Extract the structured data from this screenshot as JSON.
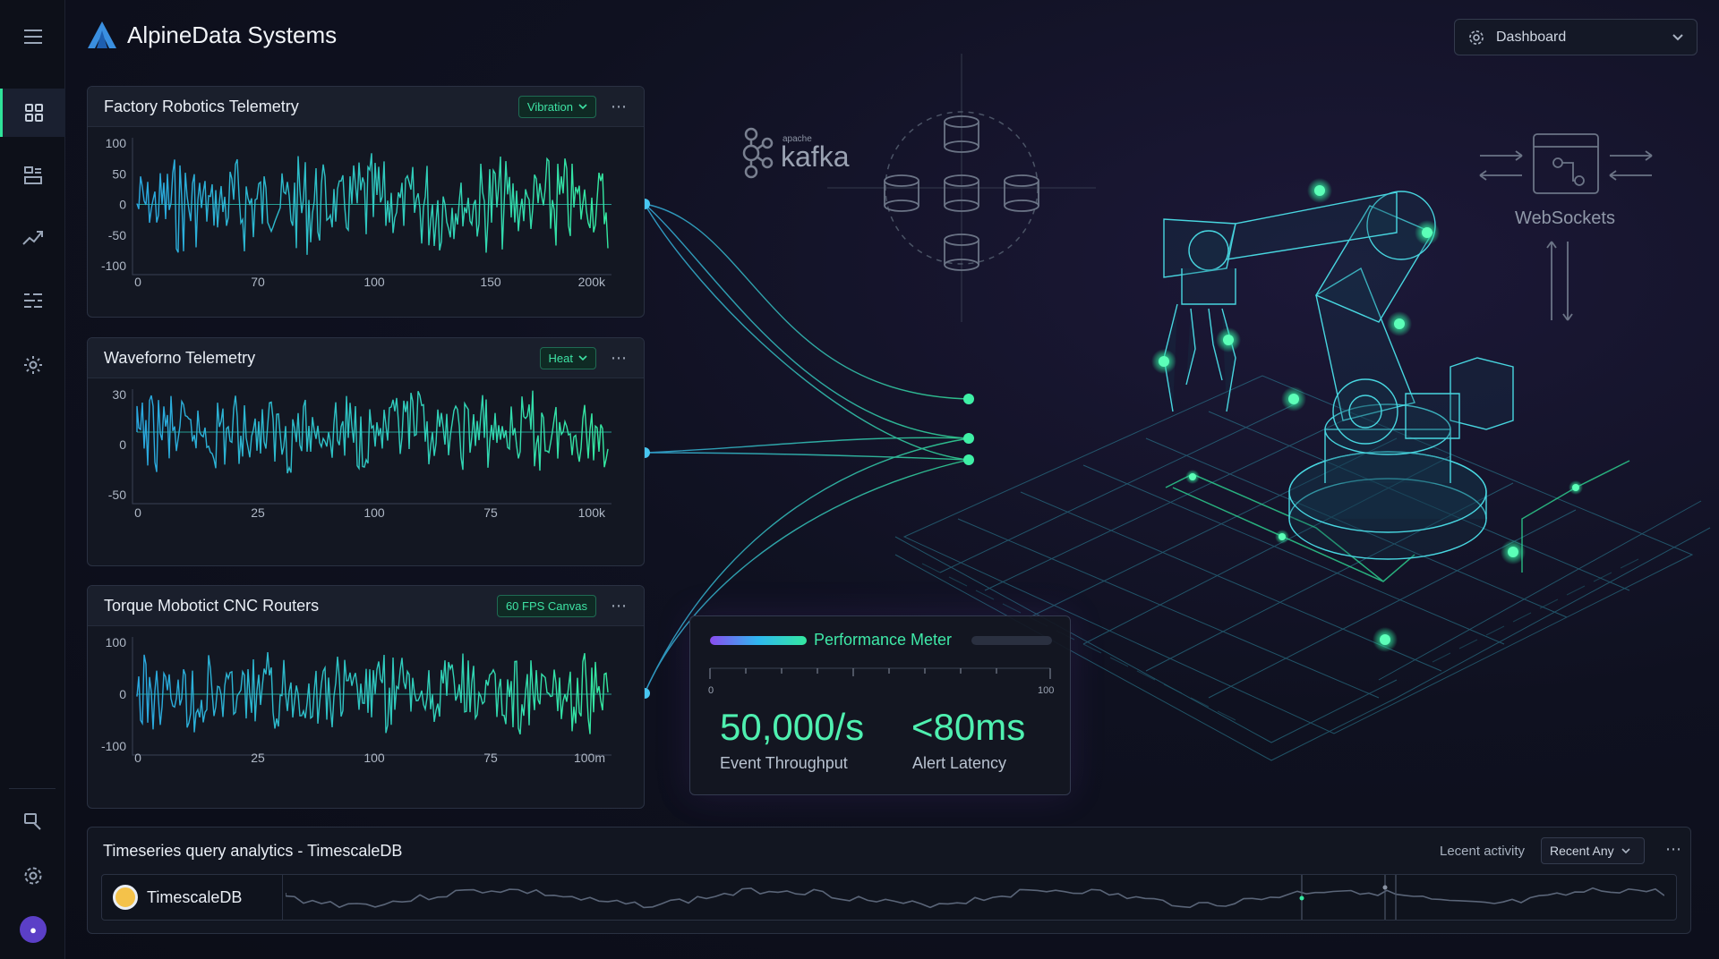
{
  "app": {
    "name": "AlpineData Systems"
  },
  "header": {
    "dashboard_select": "Dashboard"
  },
  "sidebar": {
    "items": [
      {
        "icon": "menu-icon"
      },
      {
        "icon": "dashboard-icon",
        "active": true
      },
      {
        "icon": "layout-icon"
      },
      {
        "icon": "trend-icon"
      },
      {
        "icon": "list-icon"
      },
      {
        "icon": "settings-icon"
      },
      {
        "icon": "search-icon"
      },
      {
        "icon": "gear-icon"
      }
    ]
  },
  "panels": [
    {
      "title": "Factory Robotics Telemetry",
      "badge": "Vibration",
      "y_ticks": [
        "100",
        "50",
        "0",
        "-50",
        "-100"
      ],
      "x_ticks": [
        "0",
        "70",
        "100",
        "150",
        "200k"
      ],
      "ylim": [
        -100,
        100
      ]
    },
    {
      "title": "Waveforno Telemetry",
      "badge": "Heat",
      "y_ticks": [
        "30",
        "0",
        "-50"
      ],
      "x_ticks": [
        "0",
        "25",
        "100",
        "75",
        "100k"
      ],
      "ylim": [
        -50,
        30
      ]
    },
    {
      "title": "Torque Mobotict CNC Routers",
      "badge": "60 FPS Canvas",
      "y_ticks": [
        "100",
        "0",
        "-100"
      ],
      "x_ticks": [
        "0",
        "25",
        "100",
        "75",
        "100m"
      ],
      "ylim": [
        -100,
        100
      ]
    }
  ],
  "diagram": {
    "kafka_small": "apache",
    "kafka_label": "kafka",
    "websockets_label": "WebSockets"
  },
  "performance": {
    "title": "Performance Meter",
    "scale_min": "0",
    "scale_max": "100",
    "throughput_value": "50,000/s",
    "throughput_label": "Event Throughput",
    "latency_value": "<80ms",
    "latency_label": "Alert Latency"
  },
  "bottom": {
    "title": "Timeseries query analytics - TimescaleDB",
    "recent_label": "Lecent activity",
    "recent_select": "Recent Any",
    "source_label": "TimescaleDB"
  },
  "colors": {
    "accent": "#2fe39a",
    "wave_start": "#2aa8e0",
    "wave_end": "#34e8a0"
  }
}
